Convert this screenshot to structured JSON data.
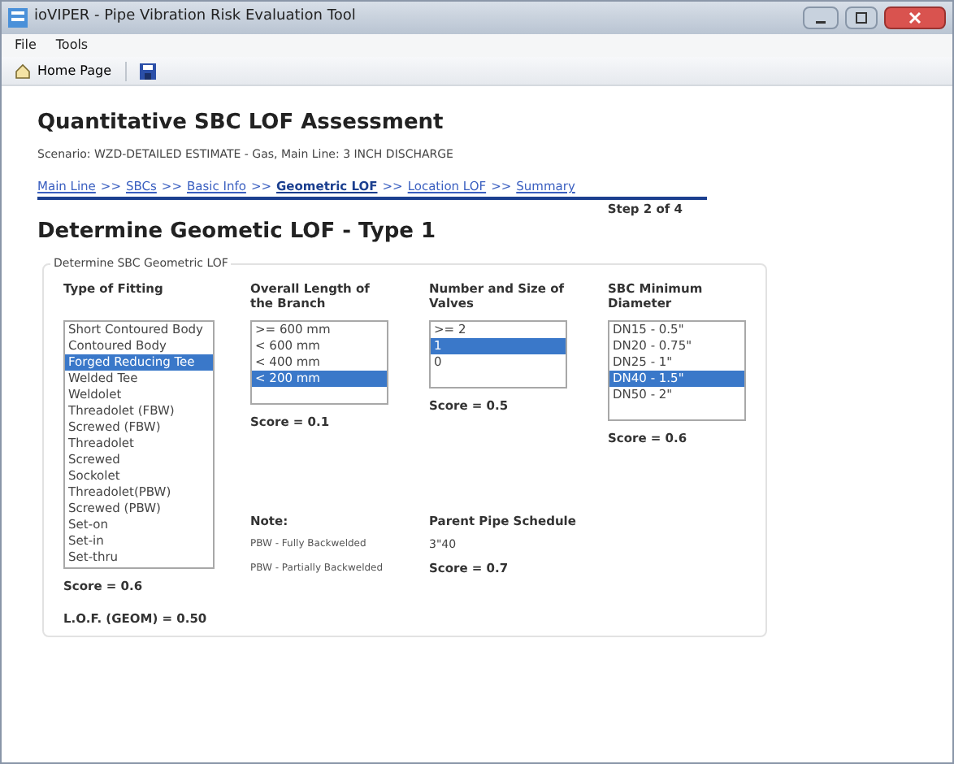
{
  "window": {
    "title": "ioVIPER - Pipe Vibration Risk Evaluation Tool"
  },
  "menu": [
    "File",
    "Tools"
  ],
  "toolbar": {
    "home": "Home Page"
  },
  "heading": "Quantitative SBC LOF Assessment",
  "scenario": "Scenario: WZD-DETAILED ESTIMATE - Gas, Main Line: 3 INCH DISCHARGE",
  "breadcrumbs": [
    {
      "kind": "link",
      "label": "Main Line",
      "selected": false
    },
    {
      "kind": "separator",
      "label": ">>"
    },
    {
      "kind": "link",
      "label": "SBCs",
      "selected": false
    },
    {
      "kind": "separator",
      "label": ">>"
    },
    {
      "kind": "link",
      "label": "Basic Info",
      "selected": false
    },
    {
      "kind": "separator",
      "label": ">>"
    },
    {
      "kind": "link",
      "label": "Geometric LOF",
      "selected": true
    },
    {
      "kind": "separator",
      "label": ">>"
    },
    {
      "kind": "link",
      "label": "Location LOF",
      "selected": false
    },
    {
      "kind": "separator",
      "label": ">>"
    },
    {
      "kind": "link",
      "label": "Summary",
      "selected": false
    }
  ],
  "step": "Step 2 of 4",
  "subheading": "Determine Geometic LOF - Type 1",
  "group": {
    "title": "Determine SBC Geometric LOF",
    "lists": [
      {
        "label": "Type of Fitting",
        "score": "Score = 0.6",
        "items": [
          {
            "label": "Short Contoured Body",
            "selected": false
          },
          {
            "label": "Contoured Body",
            "selected": false
          },
          {
            "label": "Forged Reducing Tee",
            "selected": true
          },
          {
            "label": "Welded Tee",
            "selected": false
          },
          {
            "label": "Weldolet",
            "selected": false
          },
          {
            "label": "Threadolet (FBW)",
            "selected": false
          },
          {
            "label": "Screwed (FBW)",
            "selected": false
          },
          {
            "label": "Threadolet",
            "selected": false
          },
          {
            "label": "Screwed",
            "selected": false
          },
          {
            "label": "Sockolet",
            "selected": false
          },
          {
            "label": "Threadolet(PBW)",
            "selected": false
          },
          {
            "label": "Screwed (PBW)",
            "selected": false
          },
          {
            "label": "Set-on",
            "selected": false
          },
          {
            "label": "Set-in",
            "selected": false
          },
          {
            "label": "Set-thru",
            "selected": false
          }
        ]
      },
      {
        "label": "Overall Length of the Branch",
        "score": "Score = 0.1",
        "items": [
          {
            "label": ">= 600 mm",
            "selected": false
          },
          {
            "label": "< 600 mm",
            "selected": false
          },
          {
            "label": "< 400 mm",
            "selected": false
          },
          {
            "label": "< 200 mm",
            "selected": true
          }
        ]
      },
      {
        "label": "Number and Size of Valves",
        "score": "Score = 0.5",
        "items": [
          {
            "label": ">= 2",
            "selected": false
          },
          {
            "label": "1",
            "selected": true
          },
          {
            "label": "0",
            "selected": false
          }
        ]
      },
      {
        "label": "SBC Minimum Diameter",
        "score": "Score = 0.6",
        "items": [
          {
            "label": "DN15 - 0.5\"",
            "selected": false
          },
          {
            "label": "DN20 - 0.75\"",
            "selected": false
          },
          {
            "label": "DN25 - 1\"",
            "selected": false
          },
          {
            "label": "DN40 - 1.5\"",
            "selected": true
          },
          {
            "label": "DN50 - 2\"",
            "selected": false
          }
        ]
      }
    ],
    "note": {
      "label": "Note:",
      "lines": [
        "PBW - Fully Backwelded",
        "PBW - Partially Backwelded"
      ]
    },
    "schedule": {
      "label": "Parent Pipe Schedule",
      "value": "3\"40",
      "score": "Score = 0.7"
    },
    "total": "L.O.F. (GEOM) = 0.50"
  }
}
